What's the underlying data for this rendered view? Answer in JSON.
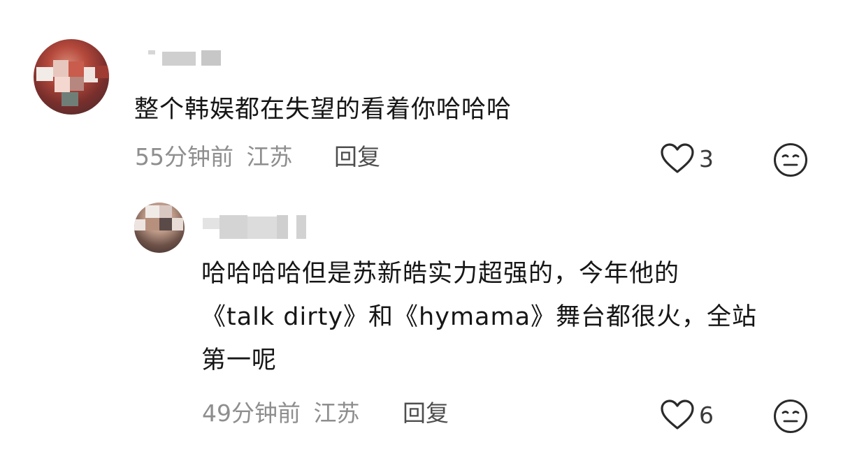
{
  "comments": [
    {
      "text_lines": [
        "整个韩娱都在失望的看着你哈哈哈"
      ],
      "time": "55分钟前",
      "location": "江苏",
      "reply_label": "回复",
      "like_count": "3"
    },
    {
      "text_lines": [
        "哈哈哈哈但是苏新皓实力超强的，今年他的",
        "《talk dirty》和《hymama》舞台都很火，全站",
        "第一呢"
      ],
      "time": "49分钟前",
      "location": "江苏",
      "reply_label": "回复",
      "like_count": "6"
    }
  ],
  "icons": {
    "like": "heart-outline-icon",
    "dislike": "meh-face-icon"
  },
  "colors": {
    "text": "#161616",
    "meta": "#8e8e8e",
    "reply": "#4e4e4e",
    "icon": "#2a2a2a"
  }
}
